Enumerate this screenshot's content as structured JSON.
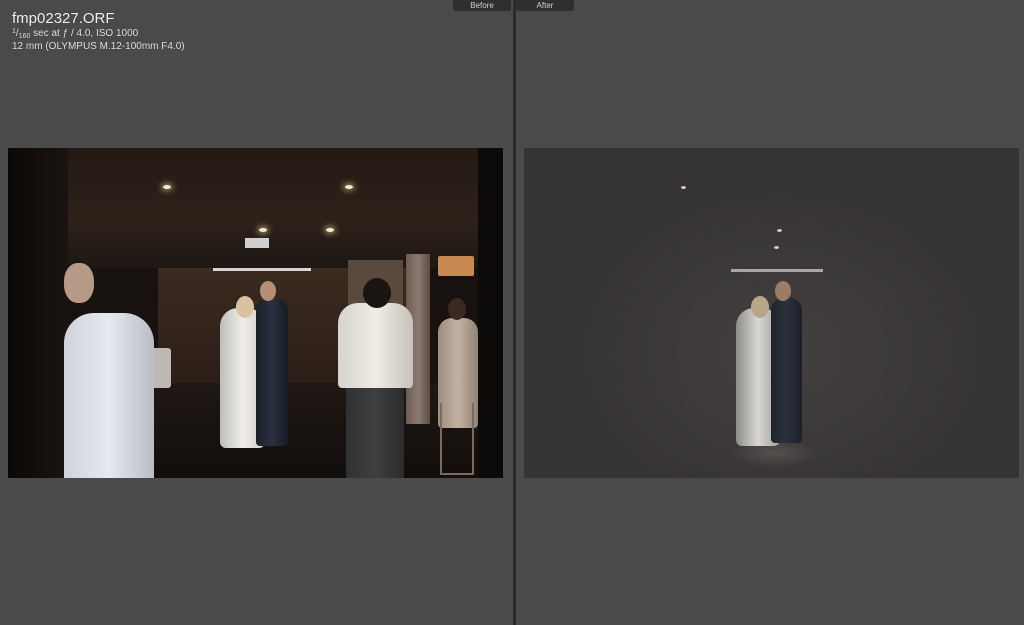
{
  "app": {
    "title": ""
  },
  "tabs": {
    "before_label": "Before",
    "after_label": "After"
  },
  "photo_info": {
    "filename": "fmp02327.ORF",
    "shutter_numerator": "1",
    "shutter_denominator": "160",
    "exposure_rest": " sec at ƒ / 4.0, ISO 1000",
    "lens": "12 mm (OLYMPUS M.12-100mm F4.0)"
  },
  "colors": {
    "background": "#4a4a4a",
    "divider": "#2b2b2b",
    "tab_bg": "#2f2f2f",
    "tab_text": "#cfcfcf"
  },
  "icons": {
    "before_photo": "wedding-dance-photo",
    "after_photo": "wedding-dance-photo-edited"
  }
}
